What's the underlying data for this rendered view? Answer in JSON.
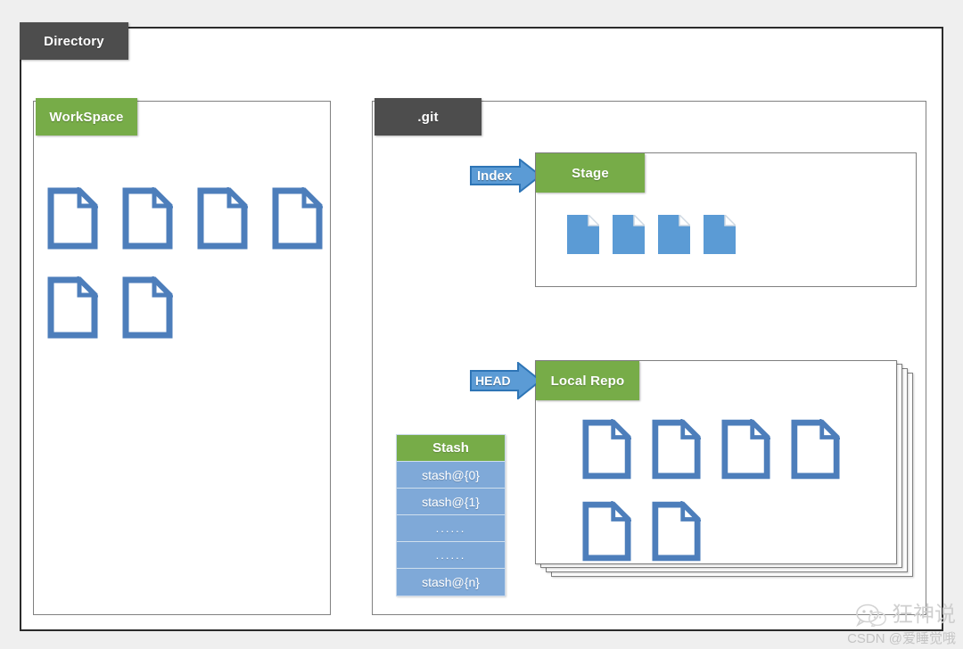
{
  "diagram": {
    "title": "Git Directory Structure",
    "colors": {
      "background": "#efefef",
      "frame_border": "#2b2b2b",
      "tab_dark": "#4d4d4d",
      "tab_green": "#77ac48",
      "arrow_blue": "#5b9bd5",
      "arrow_border": "#2e75b6",
      "doc_outline": "#4d7ebb",
      "doc_fill": "#5b9bd5",
      "stash_row": "#7fa9d8",
      "box_border": "#808080"
    }
  },
  "outer": {
    "label": "Directory"
  },
  "workspace": {
    "label": "WorkSpace",
    "documents": [
      {
        "name": "document-1"
      },
      {
        "name": "document-2"
      },
      {
        "name": "document-3"
      },
      {
        "name": "document-4"
      },
      {
        "name": "document-5"
      },
      {
        "name": "document-6"
      }
    ],
    "document_count": 6,
    "document_style": "outlined"
  },
  "git": {
    "label": ".git"
  },
  "index_arrow": {
    "label": "Index",
    "icon": "block-arrow-right-icon"
  },
  "stage": {
    "label": "Stage",
    "documents": [
      {
        "name": "staged-document-1"
      },
      {
        "name": "staged-document-2"
      },
      {
        "name": "staged-document-3"
      },
      {
        "name": "staged-document-4"
      }
    ],
    "document_count": 4,
    "document_style": "filled"
  },
  "head_arrow": {
    "label": "HEAD",
    "icon": "block-arrow-right-icon"
  },
  "local_repo": {
    "label": "Local Repo",
    "documents": [
      {
        "name": "repo-document-1"
      },
      {
        "name": "repo-document-2"
      },
      {
        "name": "repo-document-3"
      },
      {
        "name": "repo-document-4"
      },
      {
        "name": "repo-document-5"
      },
      {
        "name": "repo-document-6"
      }
    ],
    "document_count": 6,
    "document_style": "outlined",
    "stack_layers": 3
  },
  "stash": {
    "header": "Stash",
    "rows": [
      "stash@{0}",
      "stash@{1}",
      "......",
      "......",
      "stash@{n}"
    ]
  },
  "watermark": {
    "handle": "狂神说",
    "credit": "CSDN @爱睡觉哦",
    "icon": "wechat-icon"
  }
}
